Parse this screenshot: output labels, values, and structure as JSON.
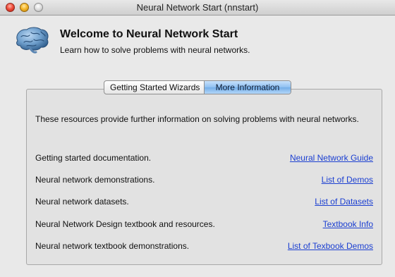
{
  "window": {
    "title": "Neural Network Start (nnstart)"
  },
  "header": {
    "title": "Welcome to Neural Network Start",
    "subtitle": "Learn how to solve problems with neural networks.",
    "icon": "brain-icon"
  },
  "tabs": [
    {
      "label": "Getting Started Wizards",
      "active": false
    },
    {
      "label": "More Information",
      "active": true
    }
  ],
  "panel": {
    "description": "These resources provide further information on solving problems with neural networks.",
    "rows": [
      {
        "label": "Getting started documentation.",
        "link": "Neural Network Guide"
      },
      {
        "label": "Neural network demonstrations.",
        "link": "List of Demos"
      },
      {
        "label": "Neural network datasets.",
        "link": "List of Datasets"
      },
      {
        "label": "Neural Network Design textbook and resources.",
        "link": "Textbook Info"
      },
      {
        "label": "Neural network textbook demonstrations.",
        "link": "List of Texbook Demos"
      }
    ]
  },
  "colors": {
    "link": "#1b3fd1",
    "active_tab": "#8ebff2",
    "window_bg": "#e9e9e9"
  }
}
